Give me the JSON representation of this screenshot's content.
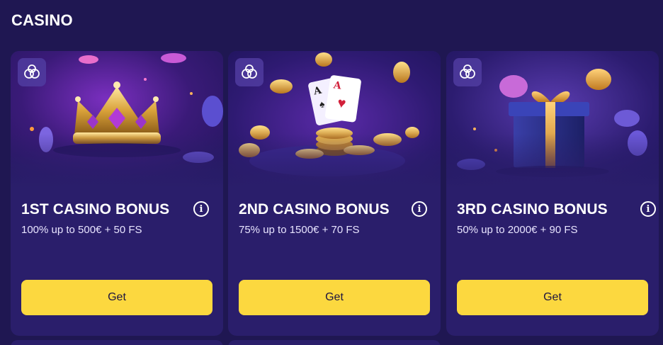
{
  "section": {
    "title": "CASINO"
  },
  "cards": [
    {
      "title": "1ST CASINO BONUS",
      "description": "100% up to 500€ + 50 FS",
      "button_label": "Get",
      "image": "golden-crown",
      "badge_icon": "casino-chips-icon"
    },
    {
      "title": "2ND CASINO BONUS",
      "description": "75% up to 1500€ + 70 FS",
      "button_label": "Get",
      "image": "aces-and-coins",
      "badge_icon": "casino-chips-icon"
    },
    {
      "title": "3RD CASINO BONUS",
      "description": "50% up to 2000€ + 90 FS",
      "button_label": "Get",
      "image": "gift-box",
      "badge_icon": "casino-chips-icon"
    }
  ],
  "colors": {
    "background": "#1f1752",
    "card": "#2a1e6b",
    "button": "#fcd83f",
    "button_text": "#1d1440"
  }
}
